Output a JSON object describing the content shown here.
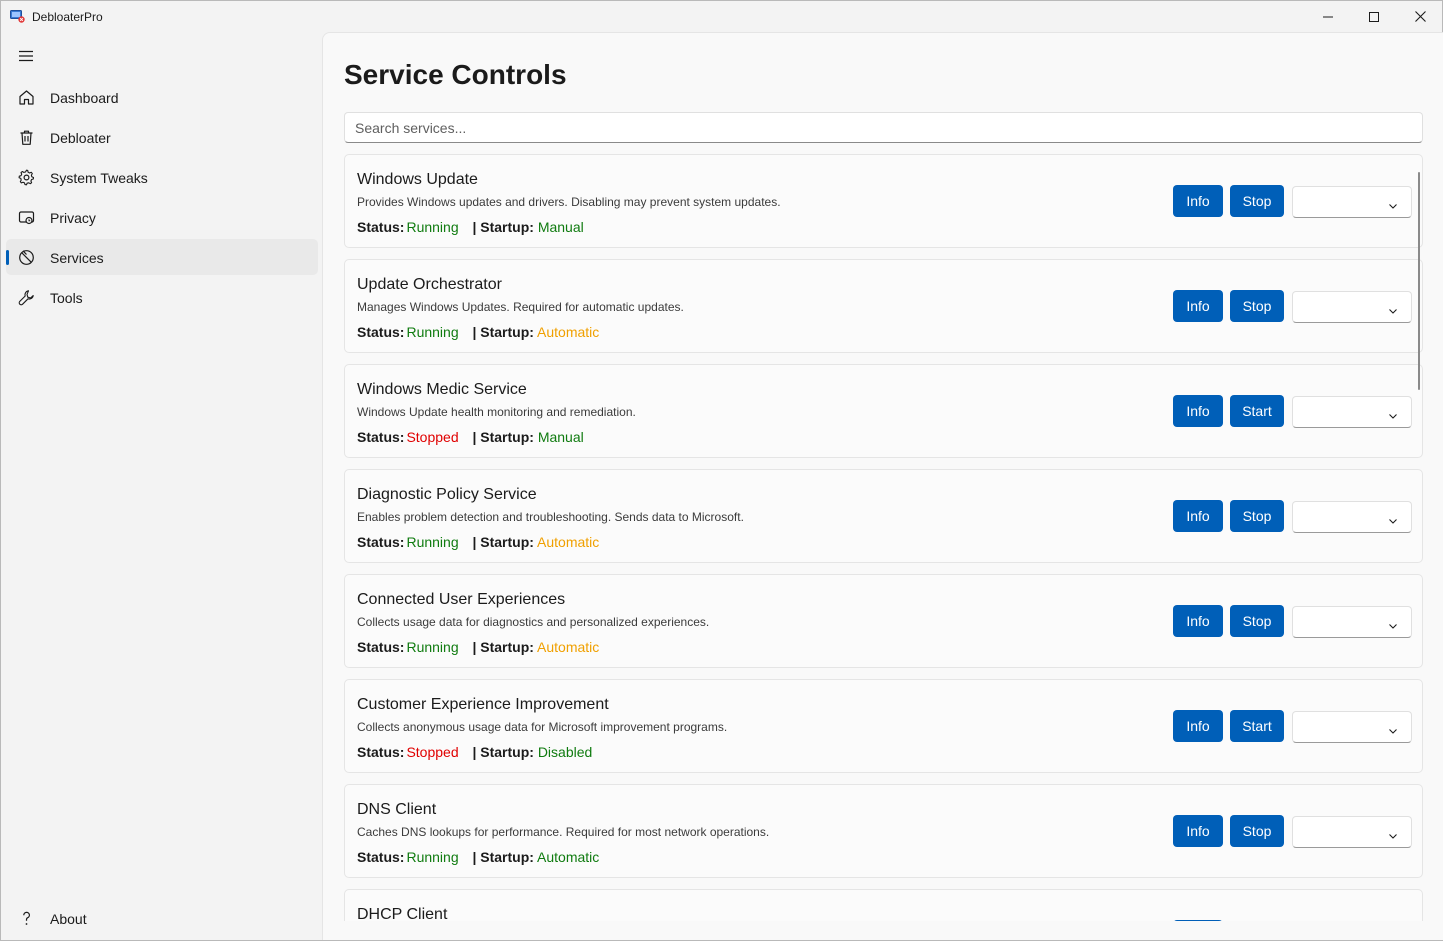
{
  "app": {
    "title": "DebloaterPro"
  },
  "sidebar": {
    "items": [
      {
        "label": "Dashboard",
        "icon": "home-icon"
      },
      {
        "label": "Debloater",
        "icon": "trash-icon"
      },
      {
        "label": "System Tweaks",
        "icon": "gear-icon"
      },
      {
        "label": "Privacy",
        "icon": "shield-lock-icon"
      },
      {
        "label": "Services",
        "icon": "services-icon",
        "active": true
      },
      {
        "label": "Tools",
        "icon": "wrench-icon"
      }
    ],
    "about_label": "About"
  },
  "main": {
    "title": "Service Controls",
    "search_placeholder": "Search services..."
  },
  "labels": {
    "status": "Status:",
    "startup": "| Startup:",
    "info": "Info"
  },
  "colors": {
    "accent": "#005fb8",
    "running": "#0f7b0f",
    "stopped": "#e00000",
    "automatic": "#f0a000"
  },
  "services": [
    {
      "name": "Windows Update",
      "desc": "Provides Windows updates and drivers. Disabling may prevent system updates.",
      "status": "Running",
      "startup": "Manual",
      "action": "Stop"
    },
    {
      "name": "Update Orchestrator",
      "desc": "Manages Windows Updates. Required for automatic updates.",
      "status": "Running",
      "startup": "Automatic",
      "action": "Stop"
    },
    {
      "name": "Windows Medic Service",
      "desc": "Windows Update health monitoring and remediation.",
      "status": "Stopped",
      "startup": "Manual",
      "action": "Start"
    },
    {
      "name": "Diagnostic Policy Service",
      "desc": "Enables problem detection and troubleshooting. Sends data to Microsoft.",
      "status": "Running",
      "startup": "Automatic",
      "action": "Stop"
    },
    {
      "name": "Connected User Experiences",
      "desc": "Collects usage data for diagnostics and personalized experiences.",
      "status": "Running",
      "startup": "Automatic",
      "action": "Stop"
    },
    {
      "name": "Customer Experience Improvement",
      "desc": "Collects anonymous usage data for Microsoft improvement programs.",
      "status": "Stopped",
      "startup": "Disabled",
      "action": "Start"
    },
    {
      "name": "DNS Client",
      "desc": "Caches DNS lookups for performance. Required for most network operations.",
      "status": "Running",
      "startup": "Automatic",
      "action": "Stop"
    },
    {
      "name": "DHCP Client",
      "desc": "",
      "status": "",
      "startup": "",
      "action": ""
    }
  ]
}
